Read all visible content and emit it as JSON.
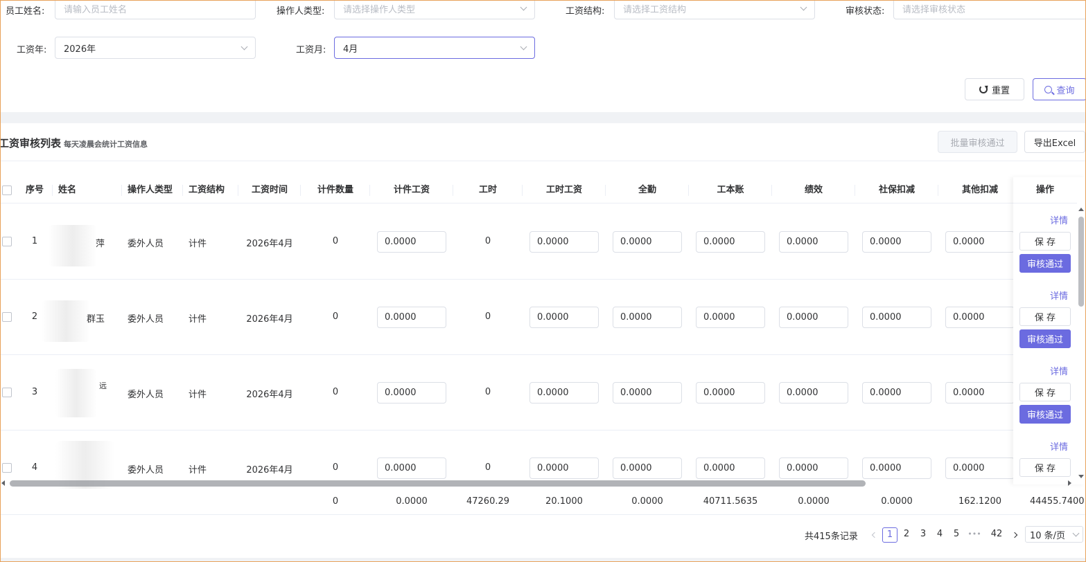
{
  "filters": {
    "employee_name": {
      "label": "员工姓名:",
      "placeholder": "请输入员工姓名"
    },
    "operator_type": {
      "label": "操作人类型:",
      "placeholder": "请选择操作人类型"
    },
    "salary_structure": {
      "label": "工资结构:",
      "placeholder": "请选择工资结构"
    },
    "review_status": {
      "label": "审核状态:",
      "placeholder": "请选择审核状态"
    },
    "salary_year": {
      "label": "工资年:",
      "value": "2026年"
    },
    "salary_month": {
      "label": "工资月:",
      "value": "4月"
    },
    "reset_label": "重置",
    "search_label": "查询"
  },
  "list": {
    "title": "工资审核列表",
    "subtitle": "每天凌晨会统计工资信息",
    "batch_approve_label": "批量审核通过",
    "export_label": "导出Excel"
  },
  "table": {
    "columns": [
      "序号",
      "姓名",
      "操作人类型",
      "工资结构",
      "工资时间",
      "计件数量",
      "计件工资",
      "工时",
      "工时工资",
      "全勤",
      "工本账",
      "绩效",
      "社保扣减",
      "其他扣减",
      "操作"
    ],
    "rows": [
      {
        "index": "1",
        "name": "萍",
        "operator_type": "委外人员",
        "structure": "计件",
        "time": "2026年4月",
        "piece_count": "0",
        "piece_wage": "0.0000",
        "hours": "0",
        "hour_wage": "0.0000",
        "attendance": "0.0000",
        "ledger": "0.0000",
        "performance": "0.0000",
        "social_deduct": "0.0000",
        "other_deduct": "0.0000"
      },
      {
        "index": "2",
        "name": "群玉",
        "operator_type": "委外人员",
        "structure": "计件",
        "time": "2026年4月",
        "piece_count": "0",
        "piece_wage": "0.0000",
        "hours": "0",
        "hour_wage": "0.0000",
        "attendance": "0.0000",
        "ledger": "0.0000",
        "performance": "0.0000",
        "social_deduct": "0.0000",
        "other_deduct": "0.0000"
      },
      {
        "index": "3",
        "name": "远",
        "operator_type": "委外人员",
        "structure": "计件",
        "time": "2026年4月",
        "piece_count": "0",
        "piece_wage": "0.0000",
        "hours": "0",
        "hour_wage": "0.0000",
        "attendance": "0.0000",
        "ledger": "0.0000",
        "performance": "0.0000",
        "social_deduct": "0.0000",
        "other_deduct": "0.0000"
      },
      {
        "index": "4",
        "name": "",
        "operator_type": "委外人员",
        "structure": "计件",
        "time": "2026年4月",
        "piece_count": "0",
        "piece_wage": "0.0000",
        "hours": "0",
        "hour_wage": "0.0000",
        "attendance": "0.0000",
        "ledger": "0.0000",
        "performance": "0.0000",
        "social_deduct": "0.0000",
        "other_deduct": "0.0000"
      }
    ],
    "actions": {
      "detail": "详情",
      "save": "保 存",
      "approve": "审核通过"
    },
    "summary": [
      "0",
      "0.0000",
      "47260.29",
      "20.1000",
      "0.0000",
      "40711.5635",
      "0.0000",
      "0.0000",
      "162.1200",
      "44455.7400"
    ]
  },
  "pagination": {
    "total_text": "共415条记录",
    "pages": [
      "1",
      "2",
      "3",
      "4",
      "5",
      "•••",
      "42"
    ],
    "page_size": "10 条/页"
  },
  "colors": {
    "primary": "#6b6be0",
    "border": "#dcdfe6"
  }
}
